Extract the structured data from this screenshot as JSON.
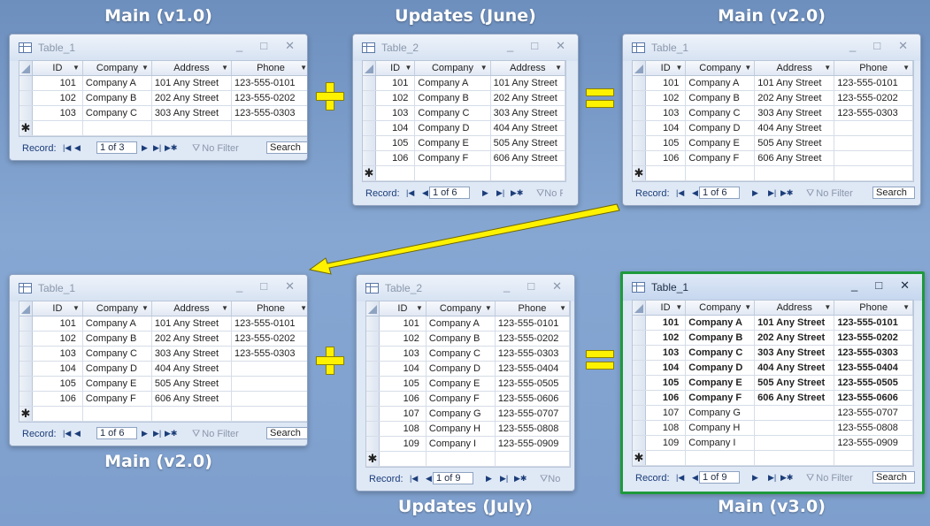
{
  "captions": {
    "main_v1": "Main (v1.0)",
    "updates_june": "Updates (June)",
    "main_v2_top": "Main (v2.0)",
    "main_v2_bottom": "Main (v2.0)",
    "updates_july": "Updates (July)",
    "main_v3": "Main (v3.0)"
  },
  "windows": {
    "w1": {
      "title": "Table_1",
      "columns": [
        "ID",
        "Company",
        "Address",
        "Phone"
      ],
      "rows": [
        [
          "101",
          "Company A",
          "101 Any Street",
          "123-555-0101"
        ],
        [
          "102",
          "Company B",
          "202 Any Street",
          "123-555-0202"
        ],
        [
          "103",
          "Company C",
          "303 Any Street",
          "123-555-0303"
        ]
      ],
      "nav": {
        "record_label": "Record:",
        "position": "1 of 3",
        "filter": "No Filter",
        "search": "Search"
      }
    },
    "w2": {
      "title": "Table_2",
      "columns": [
        "ID",
        "Company",
        "Address"
      ],
      "rows": [
        [
          "101",
          "Company A",
          "101 Any Street"
        ],
        [
          "102",
          "Company B",
          "202 Any Street"
        ],
        [
          "103",
          "Company C",
          "303 Any Street"
        ],
        [
          "104",
          "Company D",
          "404 Any Street"
        ],
        [
          "105",
          "Company E",
          "505 Any Street"
        ],
        [
          "106",
          "Company F",
          "606 Any Street"
        ]
      ],
      "nav": {
        "record_label": "Record:",
        "position": "1 of 6",
        "filter": "No F",
        "search": ""
      }
    },
    "w3": {
      "title": "Table_1",
      "columns": [
        "ID",
        "Company",
        "Address",
        "Phone"
      ],
      "rows": [
        [
          "101",
          "Company A",
          "101 Any Street",
          "123-555-0101"
        ],
        [
          "102",
          "Company B",
          "202 Any Street",
          "123-555-0202"
        ],
        [
          "103",
          "Company C",
          "303 Any Street",
          "123-555-0303"
        ],
        [
          "104",
          "Company D",
          "404 Any Street",
          ""
        ],
        [
          "105",
          "Company E",
          "505 Any Street",
          ""
        ],
        [
          "106",
          "Company F",
          "606 Any Street",
          ""
        ]
      ],
      "nav": {
        "record_label": "Record:",
        "position": "1 of 6",
        "filter": "No Filter",
        "search": "Search"
      }
    },
    "w4": {
      "title": "Table_1",
      "columns": [
        "ID",
        "Company",
        "Address",
        "Phone"
      ],
      "rows": [
        [
          "101",
          "Company A",
          "101 Any Street",
          "123-555-0101"
        ],
        [
          "102",
          "Company B",
          "202 Any Street",
          "123-555-0202"
        ],
        [
          "103",
          "Company C",
          "303 Any Street",
          "123-555-0303"
        ],
        [
          "104",
          "Company D",
          "404 Any Street",
          ""
        ],
        [
          "105",
          "Company E",
          "505 Any Street",
          ""
        ],
        [
          "106",
          "Company F",
          "606 Any Street",
          ""
        ]
      ],
      "nav": {
        "record_label": "Record:",
        "position": "1 of 6",
        "filter": "No Filter",
        "search": "Search"
      }
    },
    "w5": {
      "title": "Table_2",
      "columns": [
        "ID",
        "Company",
        "Phone"
      ],
      "rows": [
        [
          "101",
          "Company A",
          "123-555-0101"
        ],
        [
          "102",
          "Company B",
          "123-555-0202"
        ],
        [
          "103",
          "Company C",
          "123-555-0303"
        ],
        [
          "104",
          "Company D",
          "123-555-0404"
        ],
        [
          "105",
          "Company E",
          "123-555-0505"
        ],
        [
          "106",
          "Company F",
          "123-555-0606"
        ],
        [
          "107",
          "Company G",
          "123-555-0707"
        ],
        [
          "108",
          "Company H",
          "123-555-0808"
        ],
        [
          "109",
          "Company I",
          "123-555-0909"
        ]
      ],
      "nav": {
        "record_label": "Record:",
        "position": "1 of 9",
        "filter": "No",
        "search": ""
      }
    },
    "w6": {
      "title": "Table_1",
      "columns": [
        "ID",
        "Company",
        "Address",
        "Phone"
      ],
      "rows": [
        [
          "101",
          "Company A",
          "101 Any Street",
          "123-555-0101"
        ],
        [
          "102",
          "Company B",
          "202 Any Street",
          "123-555-0202"
        ],
        [
          "103",
          "Company C",
          "303 Any Street",
          "123-555-0303"
        ],
        [
          "104",
          "Company D",
          "404 Any Street",
          "123-555-0404"
        ],
        [
          "105",
          "Company E",
          "505 Any Street",
          "123-555-0505"
        ],
        [
          "106",
          "Company F",
          "606 Any Street",
          "123-555-0606"
        ],
        [
          "107",
          "Company G",
          "",
          "123-555-0707"
        ],
        [
          "108",
          "Company H",
          "",
          "123-555-0808"
        ],
        [
          "109",
          "Company I",
          "",
          "123-555-0909"
        ]
      ],
      "nav": {
        "record_label": "Record:",
        "position": "1 of 9",
        "filter": "No Filter",
        "search": "Search"
      }
    }
  },
  "colors": {
    "operator": "#fff200",
    "arrow": "#fff200",
    "highlight_border": "#1e9a3c",
    "background": "#7e9fcd"
  },
  "icons": {
    "window": "table-icon",
    "minimize": "minimize-icon",
    "maximize": "maximize-icon",
    "close": "close-icon",
    "new_record": "new-record-icon",
    "filter": "funnel-icon"
  },
  "window_buttons": {
    "minimize": "_",
    "maximize": "□",
    "close": "✕"
  },
  "new_record_glyph": "✱"
}
